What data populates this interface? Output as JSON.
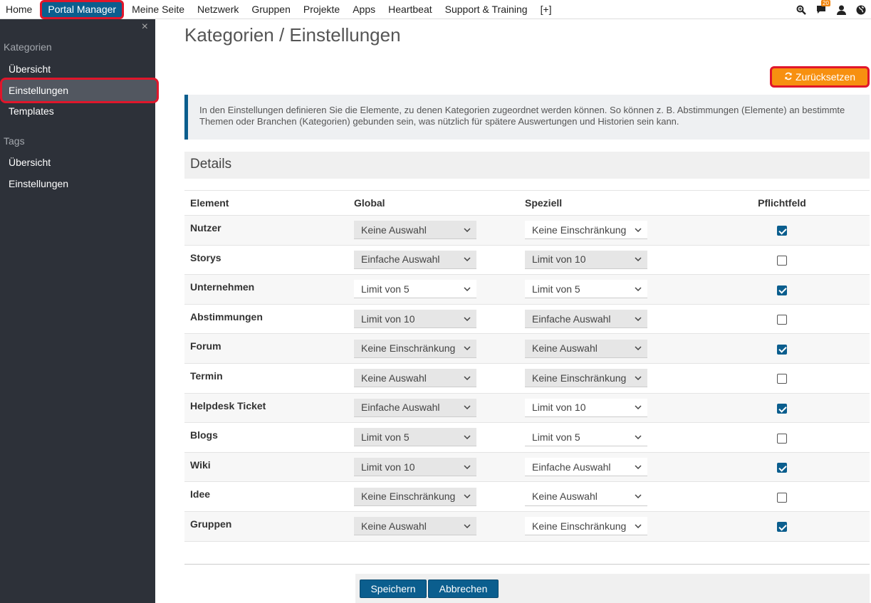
{
  "topnav": {
    "items": [
      "Home",
      "Portal Manager",
      "Meine Seite",
      "Netzwerk",
      "Gruppen",
      "Projekte",
      "Apps",
      "Heartbeat",
      "Support & Training",
      "[+]"
    ],
    "active_index": 1,
    "notification_count": "20",
    "icons": [
      "search-icon",
      "chat-icon",
      "user-icon",
      "globe-icon"
    ]
  },
  "sidebar": {
    "close_symbol": "×",
    "sections": [
      {
        "title": "Kategorien",
        "items": [
          "Übersicht",
          "Einstellungen",
          "Templates"
        ]
      },
      {
        "title": "Tags",
        "items": [
          "Übersicht",
          "Einstellungen"
        ]
      }
    ],
    "active": "Kategorien/Einstellungen"
  },
  "main": {
    "title": "Kategorien / Einstellungen",
    "reset_label": "Zurücksetzen",
    "info_text": "In den Einstellungen definieren Sie die Elemente, zu denen Kategorien zugeordnet werden können. So können z. B. Abstimmungen (Elemente) an bestimmte Themen oder Branchen (Kategorien) gebunden sein, was nützlich für spätere Auswertungen und Historien sein kann.",
    "details_title": "Details",
    "columns": [
      "Element",
      "Global",
      "Speziell",
      "Pflichtfeld"
    ],
    "rows": [
      {
        "element": "Nutzer",
        "global": "Keine Auswahl",
        "speziell": "Keine Einschränkung",
        "required": true
      },
      {
        "element": "Storys",
        "global": "Einfache Auswahl",
        "speziell": "Limit von 10",
        "required": false
      },
      {
        "element": "Unternehmen",
        "global": "Limit von 5",
        "speziell": "Limit von 5",
        "required": true
      },
      {
        "element": "Abstimmungen",
        "global": "Limit von 10",
        "speziell": "Einfache Auswahl",
        "required": false
      },
      {
        "element": "Forum",
        "global": "Keine Einschränkung",
        "speziell": "Keine Auswahl",
        "required": true
      },
      {
        "element": "Termin",
        "global": "Keine Auswahl",
        "speziell": "Keine Einschränkung",
        "required": false
      },
      {
        "element": "Helpdesk Ticket",
        "global": "Einfache Auswahl",
        "speziell": "Limit von 10",
        "required": true
      },
      {
        "element": "Blogs",
        "global": "Limit von 5",
        "speziell": "Limit von 5",
        "required": false
      },
      {
        "element": "Wiki",
        "global": "Limit von 10",
        "speziell": "Einfache Auswahl",
        "required": true
      },
      {
        "element": "Idee",
        "global": "Keine Einschränkung",
        "speziell": "Keine Auswahl",
        "required": false
      },
      {
        "element": "Gruppen",
        "global": "Keine Auswahl",
        "speziell": "Keine Einschränkung",
        "required": true
      }
    ],
    "save_label": "Speichern",
    "cancel_label": "Abbrechen"
  },
  "colors": {
    "accent": "#0b5e8e",
    "reset_button": "#f79010",
    "highlight_border": "#e0162b",
    "sidebar_bg": "#2d3139"
  }
}
